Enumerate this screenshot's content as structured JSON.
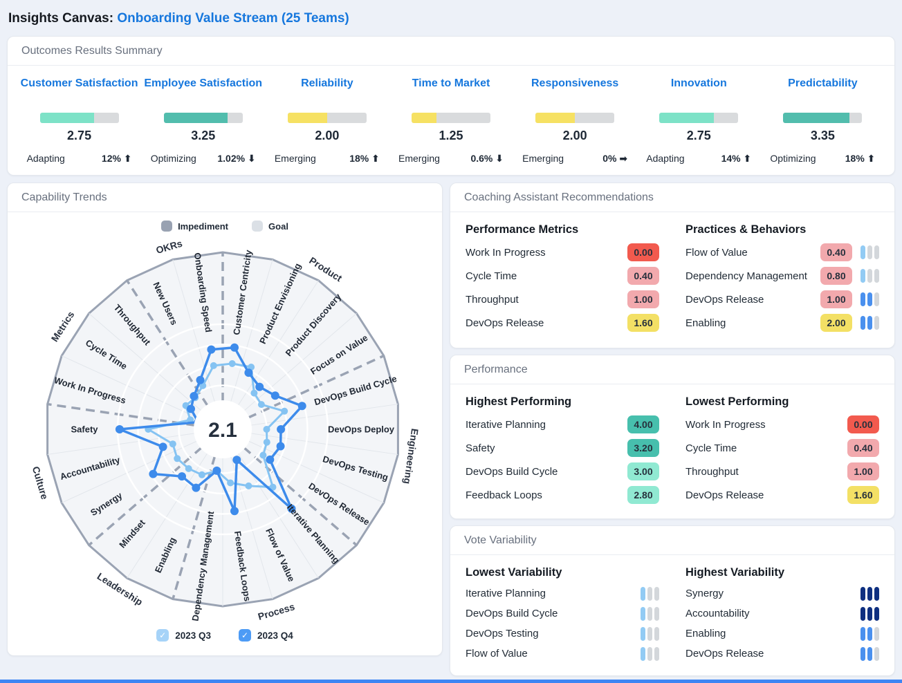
{
  "page": {
    "title_prefix": "Insights Canvas:",
    "title_link": "Onboarding Value Stream (25 Teams)"
  },
  "colors": {
    "bar_track": "#d9dbdd",
    "teal": "#52bdad",
    "teal_light": "#7de2c7",
    "yellow": "#f6e163",
    "badge_red": "#f25a4e",
    "badge_pink": "#f2a9ad",
    "badge_yellow": "#f3e065",
    "badge_teal": "#47bfad",
    "badge_teal_light": "#90e9d2",
    "bar_light_blue": "#92cbf4",
    "bar_mid_blue": "#4a90ee",
    "bar_navy": "#0e2f80",
    "bar_gray": "#d3d7db"
  },
  "outcomes": {
    "title": "Outcomes Results Summary",
    "scale_max": 4,
    "cards": [
      {
        "label": "Customer Satisfaction",
        "value": "2.75",
        "value_num": 2.75,
        "color": "teal_light",
        "level": "Adapting",
        "change": "12%",
        "trend": "up"
      },
      {
        "label": "Employee Satisfaction",
        "value": "3.25",
        "value_num": 3.25,
        "color": "teal",
        "level": "Optimizing",
        "change": "1.02%",
        "trend": "down"
      },
      {
        "label": "Reliability",
        "value": "2.00",
        "value_num": 2.0,
        "color": "yellow",
        "level": "Emerging",
        "change": "18%",
        "trend": "up"
      },
      {
        "label": "Time to Market",
        "value": "1.25",
        "value_num": 1.25,
        "color": "yellow",
        "level": "Emerging",
        "change": "0.6%",
        "trend": "down"
      },
      {
        "label": "Responsiveness",
        "value": "2.00",
        "value_num": 2.0,
        "color": "yellow",
        "level": "Emerging",
        "change": "0%",
        "trend": "flat"
      },
      {
        "label": "Innovation",
        "value": "2.75",
        "value_num": 2.75,
        "color": "teal_light",
        "level": "Adapting",
        "change": "14%",
        "trend": "up"
      },
      {
        "label": "Predictability",
        "value": "3.35",
        "value_num": 3.35,
        "color": "teal",
        "level": "Optimizing",
        "change": "18%",
        "trend": "up"
      }
    ]
  },
  "capability_trends": {
    "title": "Capability Trends",
    "legend": [
      {
        "label": "Impediment",
        "color": "#99a2b2"
      },
      {
        "label": "Goal",
        "color": "#dbe0e6"
      }
    ],
    "filters": [
      {
        "label": "2023 Q3",
        "checked": true,
        "color": "#a6d3f8"
      },
      {
        "label": "2023 Q4",
        "checked": true,
        "color": "#4d9bf5"
      }
    ],
    "chart_data": {
      "type": "radar",
      "range": [
        0,
        4
      ],
      "rings": [
        1,
        2,
        3,
        4
      ],
      "center_label": "2.1",
      "groups": [
        "Product",
        "Engineering",
        "Process",
        "Leadership",
        "Culture",
        "Metrics",
        "OKRs"
      ],
      "categories": [
        {
          "label": "Customer Centricity",
          "group": "Product"
        },
        {
          "label": "Product Envisioning",
          "group": "Product"
        },
        {
          "label": "Product Discovery",
          "group": "Product"
        },
        {
          "label": "Focus on Value",
          "group": "Product"
        },
        {
          "label": "DevOps Build Cycle",
          "group": "Engineering"
        },
        {
          "label": "DevOps Deploy",
          "group": "Engineering"
        },
        {
          "label": "DevOps Testing",
          "group": "Engineering"
        },
        {
          "label": "DevOps Release",
          "group": "Engineering"
        },
        {
          "label": "Iterative Planning",
          "group": "Process"
        },
        {
          "label": "Flow of Value",
          "group": "Process"
        },
        {
          "label": "Feedback Loops",
          "group": "Process"
        },
        {
          "label": "Dependency Management",
          "group": "Process"
        },
        {
          "label": "Enabling",
          "group": "Leadership"
        },
        {
          "label": "Mindset",
          "group": "Leadership"
        },
        {
          "label": "Synergy",
          "group": "Culture"
        },
        {
          "label": "Accountability",
          "group": "Culture"
        },
        {
          "label": "Safety",
          "group": "Culture"
        },
        {
          "label": "Work In Progress",
          "group": "Metrics"
        },
        {
          "label": "Cycle Time",
          "group": "Metrics"
        },
        {
          "label": "Throughput",
          "group": "Metrics"
        },
        {
          "label": "New Users",
          "group": "OKRs"
        },
        {
          "label": "Onboarding Speed",
          "group": "OKRs"
        }
      ],
      "series": [
        {
          "name": "2023 Q3",
          "color": "#85c3f2",
          "values": [
            2.1,
            2.2,
            1.2,
            1.1,
            2.0,
            1.0,
            1.1,
            1.2,
            2.6,
            1.9,
            1.5,
            0.9,
            1.3,
            1.4,
            1.5,
            1.4,
            2.5,
            0.5,
            1.0,
            0.9,
            1.2,
            2.0
          ]
        },
        {
          "name": "2023 Q4",
          "color": "#3d8beb",
          "values": [
            2.9,
            1.9,
            1.6,
            1.9,
            2.9,
            1.7,
            1.8,
            1.6,
            4.0,
            0.5,
            2.9,
            0.9,
            2.0,
            1.9,
            2.9,
            1.9,
            3.9,
            0.1,
            0.7,
            1.0,
            1.5,
            2.8
          ]
        }
      ]
    }
  },
  "coaching": {
    "title": "Coaching Assistant Recommendations",
    "columns": [
      {
        "heading": "Performance Metrics",
        "rows": [
          {
            "label": "Work In Progress",
            "value": "0.00",
            "badge": "red"
          },
          {
            "label": "Cycle Time",
            "value": "0.40",
            "badge": "pink"
          },
          {
            "label": "Throughput",
            "value": "1.00",
            "badge": "pink"
          },
          {
            "label": "DevOps Release",
            "value": "1.60",
            "badge": "yellow"
          }
        ]
      },
      {
        "heading": "Practices & Behaviors",
        "rows": [
          {
            "label": "Flow of Value",
            "value": "0.40",
            "badge": "pink",
            "bars": [
              "light",
              "gray",
              "gray"
            ]
          },
          {
            "label": "Dependency Management",
            "value": "0.80",
            "badge": "pink",
            "bars": [
              "light",
              "gray",
              "gray"
            ]
          },
          {
            "label": "DevOps Release",
            "value": "1.00",
            "badge": "pink",
            "bars": [
              "blue",
              "blue",
              "gray"
            ]
          },
          {
            "label": "Enabling",
            "value": "2.00",
            "badge": "yellow",
            "bars": [
              "blue",
              "blue",
              "gray"
            ]
          }
        ]
      }
    ]
  },
  "performance": {
    "title": "Performance",
    "columns": [
      {
        "heading": "Highest Performing",
        "rows": [
          {
            "label": "Iterative Planning",
            "value": "4.00",
            "badge": "teal"
          },
          {
            "label": "Safety",
            "value": "3.20",
            "badge": "teal"
          },
          {
            "label": "DevOps Build Cycle",
            "value": "3.00",
            "badge": "teal_light"
          },
          {
            "label": "Feedback Loops",
            "value": "2.80",
            "badge": "teal_light"
          }
        ]
      },
      {
        "heading": "Lowest Performing",
        "rows": [
          {
            "label": "Work In Progress",
            "value": "0.00",
            "badge": "red"
          },
          {
            "label": "Cycle Time",
            "value": "0.40",
            "badge": "pink"
          },
          {
            "label": "Throughput",
            "value": "1.00",
            "badge": "pink"
          },
          {
            "label": "DevOps Release",
            "value": "1.60",
            "badge": "yellow"
          }
        ]
      }
    ]
  },
  "vote_variability": {
    "title": "Vote Variability",
    "columns": [
      {
        "heading": "Lowest Variability",
        "rows": [
          {
            "label": "Iterative Planning",
            "bars": [
              "light",
              "gray",
              "gray"
            ]
          },
          {
            "label": "DevOps Build Cycle",
            "bars": [
              "light",
              "gray",
              "gray"
            ]
          },
          {
            "label": "DevOps Testing",
            "bars": [
              "light",
              "gray",
              "gray"
            ]
          },
          {
            "label": "Flow of Value",
            "bars": [
              "light",
              "gray",
              "gray"
            ]
          }
        ]
      },
      {
        "heading": "Highest Variability",
        "rows": [
          {
            "label": "Synergy",
            "bars": [
              "navy",
              "navy",
              "navy"
            ]
          },
          {
            "label": "Accountability",
            "bars": [
              "navy",
              "navy",
              "navy"
            ]
          },
          {
            "label": "Enabling",
            "bars": [
              "blue",
              "blue",
              "gray"
            ]
          },
          {
            "label": "DevOps Release",
            "bars": [
              "blue",
              "blue",
              "gray"
            ]
          }
        ]
      }
    ]
  }
}
